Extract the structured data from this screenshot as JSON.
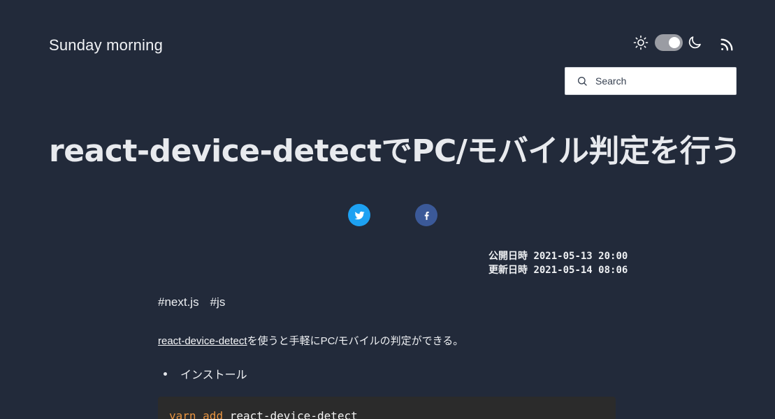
{
  "header": {
    "site_title": "Sunday morning",
    "theme_mode": "dark",
    "search": {
      "placeholder": "Search"
    }
  },
  "post": {
    "title": "react-device-detectでPC/モバイル判定を行う",
    "share": [
      {
        "network": "twitter",
        "icon": "twitter-icon",
        "color": "#1da1f2"
      },
      {
        "network": "facebook",
        "icon": "facebook-icon",
        "color": "#3b5998"
      }
    ],
    "dates": {
      "published_label": "公開日時",
      "published": "2021-05-13 20:00",
      "updated_label": "更新日時",
      "updated": "2021-05-14 08:06"
    },
    "tags": [
      "#next.js",
      "#js"
    ],
    "intro": {
      "link_text": "react-device-detect",
      "text": "を使うと手軽にPC/モバイルの判定ができる。"
    },
    "list": [
      {
        "text": "インストール"
      }
    ],
    "code": {
      "cmd1": "yarn",
      "cmd2": "add",
      "arg": "react-device-detect"
    }
  },
  "colors": {
    "background": "#222a3a",
    "code_background": "#2b2b2b",
    "code_keyword": "#e8933f"
  }
}
